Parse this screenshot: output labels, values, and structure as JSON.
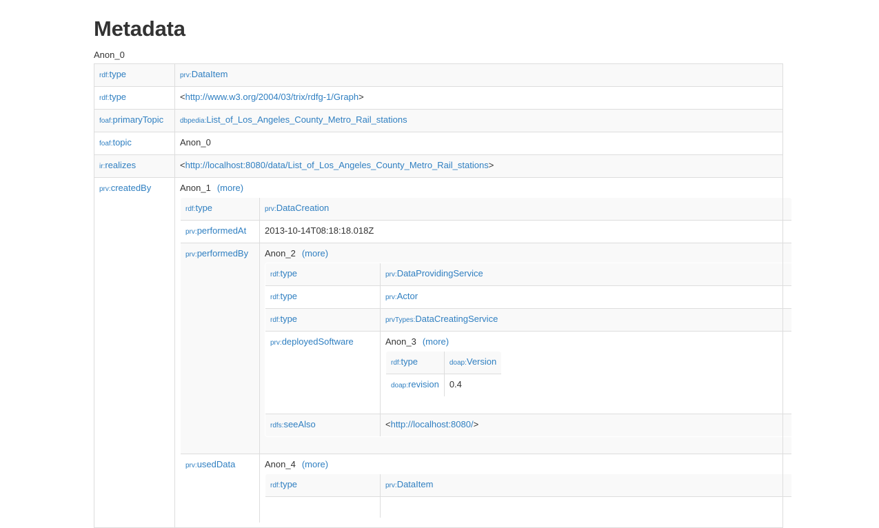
{
  "page": {
    "title": "Metadata",
    "root_label": "Anon_0"
  },
  "colors": {
    "link": "#2f7fc1",
    "text": "#333333",
    "border": "#dddddd",
    "stripe": "#f9f9f9",
    "background": "#ffffff"
  },
  "labels": {
    "more": "more",
    "paren_open": "(",
    "paren_close": ")",
    "angle_open": "<",
    "angle_close": ">"
  },
  "rows": {
    "r1": {
      "predicate_prefix": "rdf",
      "predicate_local": "type",
      "value_prefix": "prv",
      "value_local": "DataItem"
    },
    "r2": {
      "predicate_prefix": "rdf",
      "predicate_local": "type",
      "value_uri": "http://www.w3.org/2004/03/trix/rdfg-1/Graph"
    },
    "r3": {
      "predicate_prefix": "foaf",
      "predicate_local": "primaryTopic",
      "value_prefix": "dbpedia",
      "value_local": "List_of_Los_Angeles_County_Metro_Rail_stations"
    },
    "r4": {
      "predicate_prefix": "foaf",
      "predicate_local": "topic",
      "value_literal": "Anon_0"
    },
    "r5": {
      "predicate_prefix": "ir",
      "predicate_local": "realizes",
      "value_uri": "http://localhost:8080/data/List_of_Los_Angeles_County_Metro_Rail_stations"
    },
    "r6": {
      "predicate_prefix": "prv",
      "predicate_local": "createdBy",
      "value_anon": "Anon_1"
    }
  },
  "level2": {
    "n1": {
      "predicate_prefix": "rdf",
      "predicate_local": "type",
      "value_prefix": "prv",
      "value_local": "DataCreation"
    },
    "n2": {
      "predicate_prefix": "prv",
      "predicate_local": "performedAt",
      "value_literal": "2013-10-14T08:18:18.018Z"
    },
    "n3": {
      "predicate_prefix": "prv",
      "predicate_local": "performedBy",
      "value_anon": "Anon_2"
    },
    "n4": {
      "predicate_prefix": "prv",
      "predicate_local": "usedData",
      "value_anon": "Anon_4"
    }
  },
  "level3": {
    "m1": {
      "predicate_prefix": "rdf",
      "predicate_local": "type",
      "value_prefix": "prv",
      "value_local": "DataProvidingService"
    },
    "m2": {
      "predicate_prefix": "rdf",
      "predicate_local": "type",
      "value_prefix": "prv",
      "value_local": "Actor"
    },
    "m3": {
      "predicate_prefix": "rdf",
      "predicate_local": "type",
      "value_prefix": "prvTypes",
      "value_local": "DataCreatingService"
    },
    "m4": {
      "predicate_prefix": "prv",
      "predicate_local": "deployedSoftware",
      "value_anon": "Anon_3"
    },
    "m5": {
      "predicate_prefix": "rdfs",
      "predicate_local": "seeAlso",
      "value_uri": "http://localhost:8080/"
    }
  },
  "level4": {
    "k1": {
      "predicate_prefix": "rdf",
      "predicate_local": "type",
      "value_prefix": "doap",
      "value_local": "Version"
    },
    "k2": {
      "predicate_prefix": "doap",
      "predicate_local": "revision",
      "value_literal": "0.4"
    }
  },
  "level3_usedData": {
    "u1": {
      "predicate_prefix": "rdf",
      "predicate_local": "type",
      "value_prefix": "prv",
      "value_local": "DataItem"
    }
  }
}
